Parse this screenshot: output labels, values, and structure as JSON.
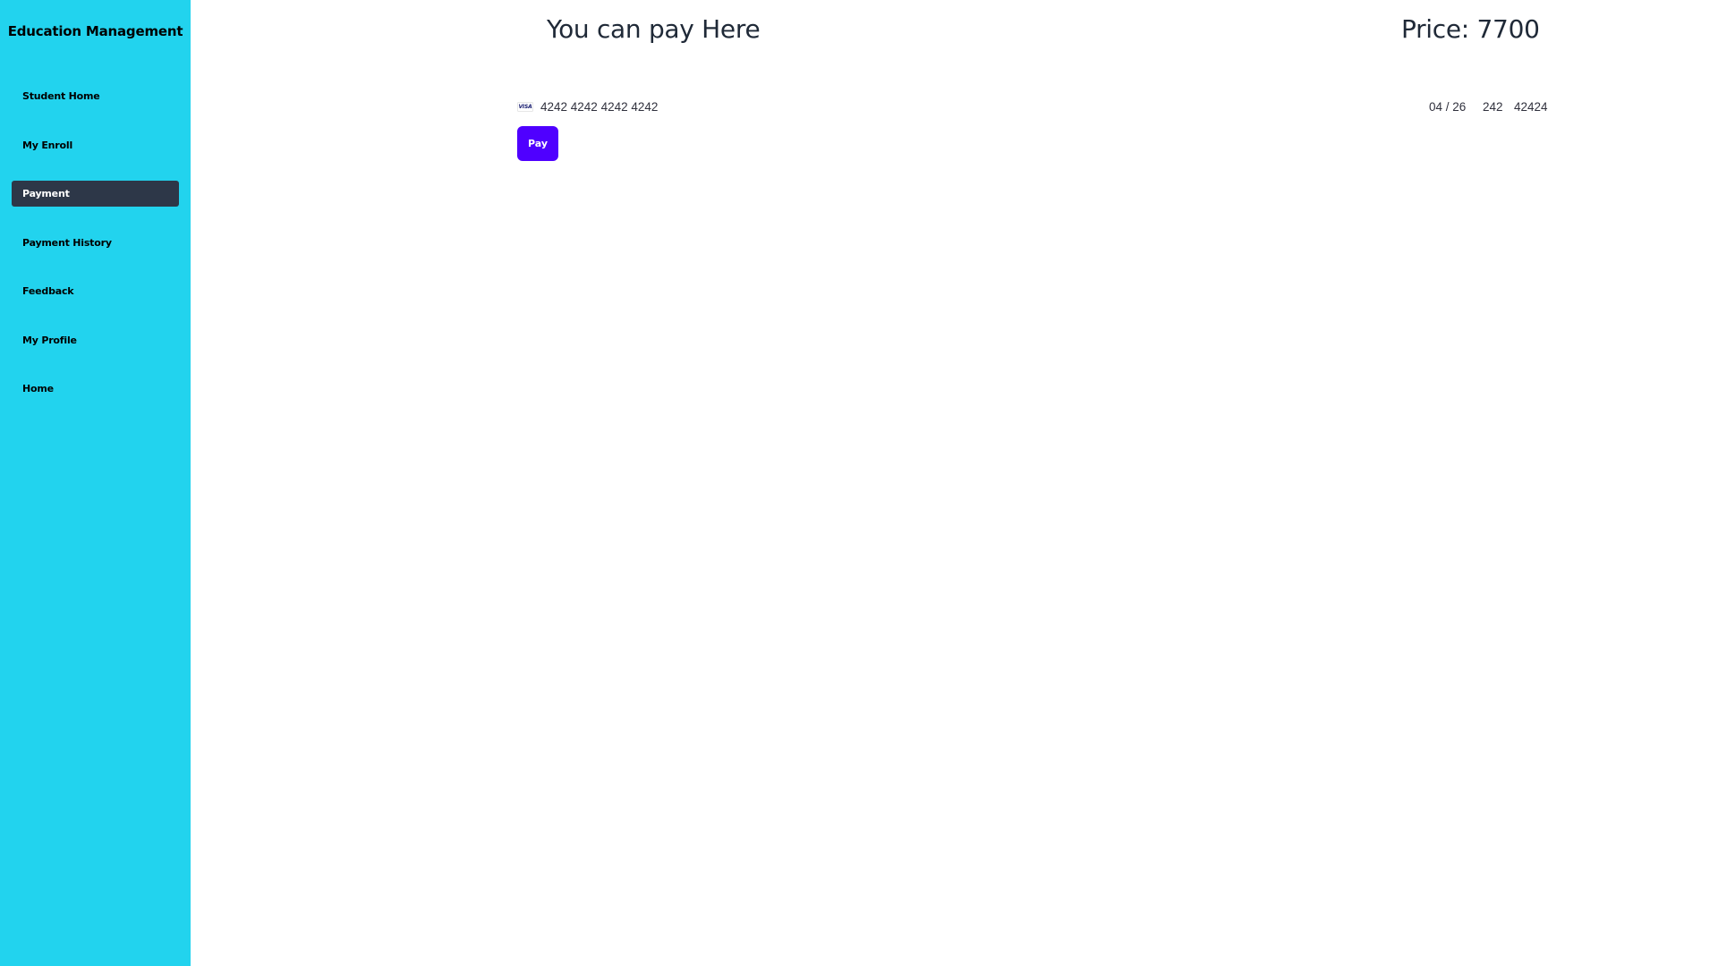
{
  "sidebar": {
    "brand": "Education Management",
    "items": [
      {
        "label": "Student Home",
        "active": false
      },
      {
        "label": "My Enroll",
        "active": false
      },
      {
        "label": "Payment",
        "active": true
      },
      {
        "label": "Payment History",
        "active": false
      },
      {
        "label": "Feedback",
        "active": false
      },
      {
        "label": "My Profile",
        "active": false
      },
      {
        "label": "Home",
        "active": false
      }
    ],
    "bg_color": "#22d3ee",
    "active_color": "#2d3748"
  },
  "main": {
    "heading": "You can pay Here",
    "price": "Price: 7700"
  },
  "card": {
    "brand_icon": "visa-icon",
    "brand_text": "VISA",
    "number": "4242 4242 4242 4242",
    "expiry": "04 / 26",
    "cvc": "242",
    "zip": "42424"
  },
  "pay_button": {
    "label": "Pay",
    "color": "#4f00ff"
  }
}
